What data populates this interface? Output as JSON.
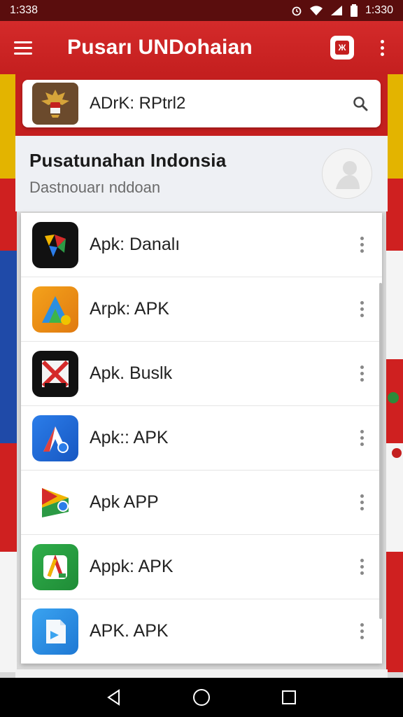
{
  "status_bar": {
    "time_left": "1:338",
    "time_right": "1:330"
  },
  "app_bar": {
    "title": "Pusarı UNDohaian",
    "action_badge": "Ж"
  },
  "search": {
    "query": "ADrK: RPtrl2"
  },
  "header": {
    "title": "Pusatunahan Indonsia",
    "subtitle": "Dastnouarı nddoan"
  },
  "list": {
    "items": [
      {
        "label": "Apk: Danalı",
        "icon": "dark-multicolor-app-icon"
      },
      {
        "label": "Arpk: APK",
        "icon": "orange-a-app-icon"
      },
      {
        "label": "Apk. Buslk",
        "icon": "crossed-out-app-icon"
      },
      {
        "label": "Apk:: APK",
        "icon": "blue-a-app-icon"
      },
      {
        "label": "Apk APP",
        "icon": "play-store-app-icon"
      },
      {
        "label": "Appk: APK",
        "icon": "green-a-app-icon"
      },
      {
        "label": "APK. APK",
        "icon": "blue-file-app-icon"
      }
    ]
  },
  "colors": {
    "brand_red": "#c41f1f",
    "status_bar": "#5a0d0d",
    "text": "#222222"
  }
}
